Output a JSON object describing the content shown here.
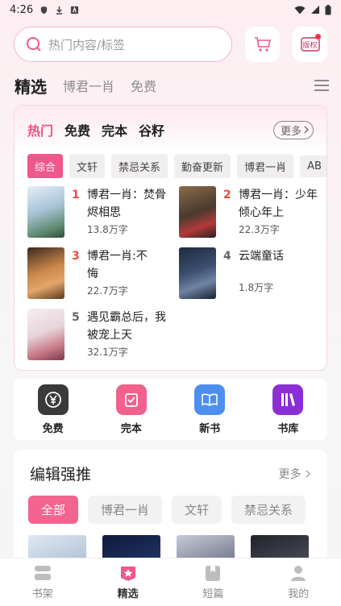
{
  "status": {
    "time": "4:26"
  },
  "search": {
    "placeholder": "热门内容/标签"
  },
  "header_icons": {
    "cart": "cart-icon",
    "rights_badge": "版权"
  },
  "top_tabs": [
    {
      "label": "精选",
      "active": true
    },
    {
      "label": "博君一肖",
      "active": false
    },
    {
      "label": "免费",
      "active": false
    }
  ],
  "hot": {
    "tabs": [
      "热门",
      "免费",
      "完本",
      "谷籽"
    ],
    "more_label": "更多",
    "chips": [
      "综合",
      "文轩",
      "禁忌关系",
      "勤奋更新",
      "博君一肖",
      "AB"
    ],
    "books": [
      {
        "rank": "1",
        "title": "博君一肖：焚骨烬相思",
        "words": "13.8万字"
      },
      {
        "rank": "2",
        "title": "博君一肖：少年倾心年上",
        "words": "22.3万字"
      },
      {
        "rank": "3",
        "title": "博君一肖:不悔",
        "words": "22.7万字"
      },
      {
        "rank": "4",
        "title": "云端童话",
        "words": "1.8万字"
      },
      {
        "rank": "5",
        "title": "遇见霸总后，我被宠上天",
        "words": "32.1万字"
      }
    ]
  },
  "quick_links": [
    "免费",
    "完本",
    "新书",
    "书库"
  ],
  "editor": {
    "title": "编辑强推",
    "more_label": "更多",
    "chips": [
      "全部",
      "博君一肖",
      "文轩",
      "禁忌关系"
    ]
  },
  "bottom_nav": [
    "书架",
    "精选",
    "短篇",
    "我的"
  ],
  "colors": {
    "accent": "#f0578b",
    "rank_red": "#f04a3d"
  }
}
